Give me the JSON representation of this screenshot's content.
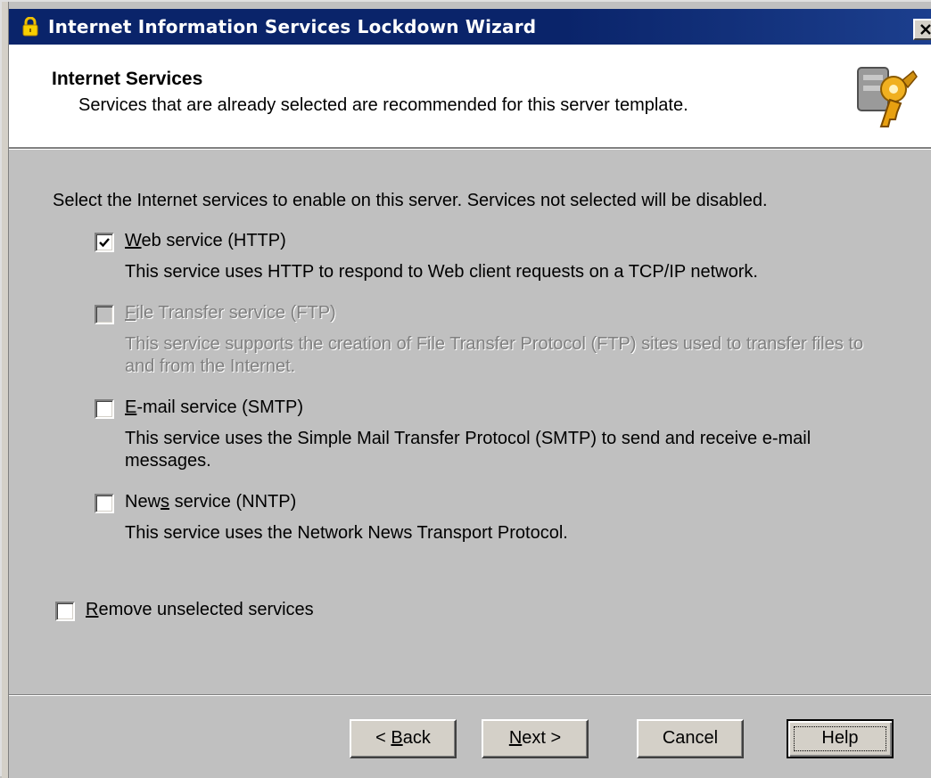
{
  "window": {
    "title": "Internet Information Services Lockdown Wizard",
    "title_icon": "lock-icon",
    "close_icon": "close-icon"
  },
  "header": {
    "title": "Internet Services",
    "subtitle": "Services that are already selected are recommended for this server template.",
    "icon": "wizard-keys-icon"
  },
  "main": {
    "intro": "Select the Internet services to enable on this server. Services not selected will be disabled.",
    "services": [
      {
        "label_pre": "",
        "label_key": "W",
        "label_post": "eb service (HTTP)",
        "description": "This service uses HTTP to respond to Web client requests on a TCP/IP network.",
        "checked": true,
        "enabled": true
      },
      {
        "label_pre": "",
        "label_key": "F",
        "label_post": "ile Transfer service (FTP)",
        "description": "This service supports the creation of File Transfer Protocol (FTP) sites used to transfer files to and from the Internet.",
        "checked": false,
        "enabled": false
      },
      {
        "label_pre": "",
        "label_key": "E",
        "label_post": "-mail service (SMTP)",
        "description": "This service uses the Simple Mail Transfer Protocol (SMTP) to send and receive e-mail messages.",
        "checked": false,
        "enabled": true
      },
      {
        "label_pre": "New",
        "label_key": "s",
        "label_post": " service (NNTP)",
        "description": "This service uses the Network News Transport Protocol.",
        "checked": false,
        "enabled": true
      }
    ],
    "remove": {
      "label_pre": "",
      "label_key": "R",
      "label_post": "emove unselected services",
      "checked": false
    }
  },
  "footer": {
    "back": {
      "pre": "< ",
      "key": "B",
      "post": "ack"
    },
    "next": {
      "pre": "",
      "key": "N",
      "post": "ext >"
    },
    "cancel": "Cancel",
    "help": "Help"
  }
}
